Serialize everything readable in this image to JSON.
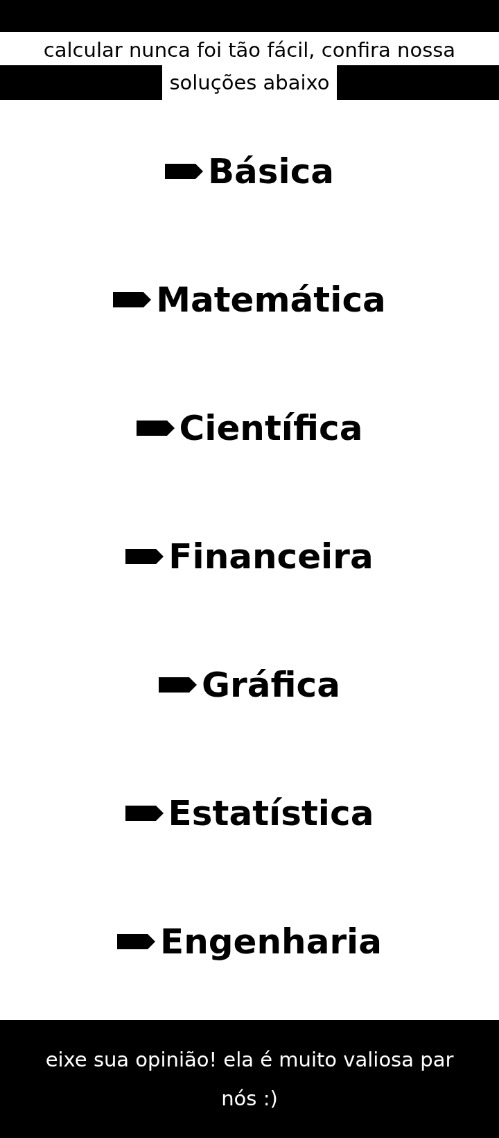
{
  "intro": {
    "line_1": "calcular nunca foi tão fácil, confira nossa",
    "line_2": "soluções abaixo"
  },
  "menu": [
    {
      "label": "Básica"
    },
    {
      "label": "Matemática"
    },
    {
      "label": "Científica"
    },
    {
      "label": "Financeira"
    },
    {
      "label": "Gráfica"
    },
    {
      "label": "Estatística"
    },
    {
      "label": "Engenharia"
    }
  ],
  "footer": {
    "line_1": "eixe sua opinião! ela é muito valiosa par",
    "line_2": "nós :)"
  }
}
